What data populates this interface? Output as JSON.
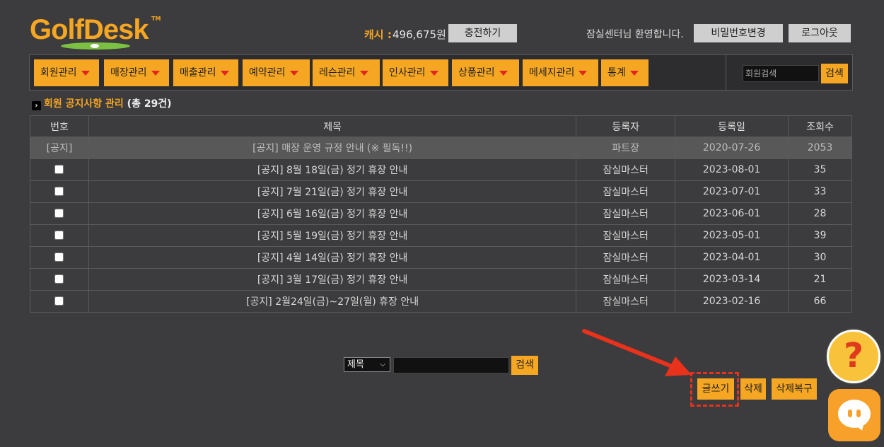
{
  "header": {
    "logo_text": "GolfDesk",
    "logo_tm": "TM",
    "cash_label": "캐시 :",
    "cash_value": "496,675원",
    "charge_label": "충전하기",
    "welcome": "잠실센터님 환영합니다.",
    "change_pw_label": "비밀번호변경",
    "logout_label": "로그아웃"
  },
  "nav": {
    "menus": [
      {
        "label": "회원관리"
      },
      {
        "label": "매장관리"
      },
      {
        "label": "매출관리"
      },
      {
        "label": "예약관리"
      },
      {
        "label": "레슨관리"
      },
      {
        "label": "인사관리"
      },
      {
        "label": "상품관리"
      },
      {
        "label": "메세지관리"
      },
      {
        "label": "통계"
      }
    ],
    "member_search_placeholder": "회원검색",
    "search_label": "검색"
  },
  "section": {
    "title": "회원 공지사항 관리",
    "count": "(총 29건)"
  },
  "table": {
    "headers": [
      "번호",
      "제목",
      "등록자",
      "등록일",
      "조회수"
    ],
    "notice": {
      "no": "[공지]",
      "title": "[공지] 매장 운영 규정 안내 (※ 필독!!)",
      "author": "파트장",
      "date": "2020-07-26",
      "views": "2053"
    },
    "rows": [
      {
        "title": "[공지] 8월 18일(금) 정기 휴장 안내",
        "author": "잠실마스터",
        "date": "2023-08-01",
        "views": "35"
      },
      {
        "title": "[공지] 7월 21일(금) 정기 휴장 안내",
        "author": "잠실마스터",
        "date": "2023-07-01",
        "views": "33"
      },
      {
        "title": "[공지] 6월 16일(금) 정기 휴장 안내",
        "author": "잠실마스터",
        "date": "2023-06-01",
        "views": "28"
      },
      {
        "title": "[공지] 5월 19일(금) 정기 휴장 안내",
        "author": "잠실마스터",
        "date": "2023-05-01",
        "views": "39"
      },
      {
        "title": "[공지] 4월 14일(금) 정기 휴장 안내",
        "author": "잠실마스터",
        "date": "2023-04-01",
        "views": "30"
      },
      {
        "title": "[공지] 3월 17일(금) 정기 휴장 안내",
        "author": "잠실마스터",
        "date": "2023-03-14",
        "views": "21"
      },
      {
        "title": "[공지] 2월24일(금)~27일(월) 휴장 안내",
        "author": "잠실마스터",
        "date": "2023-02-16",
        "views": "66"
      }
    ]
  },
  "bottom_search": {
    "select_value": "제목",
    "search_label": "검색"
  },
  "actions": {
    "write_label": "글쓰기",
    "delete_label": "삭제",
    "restore_label": "삭제복구"
  },
  "floating": {
    "help_glyph": "?",
    "help_icon": "question-icon",
    "chat_icon": "chat-icon"
  },
  "colors": {
    "accent": "#f5a623",
    "highlight": "#e8321c",
    "background": "#3c3b3d"
  }
}
